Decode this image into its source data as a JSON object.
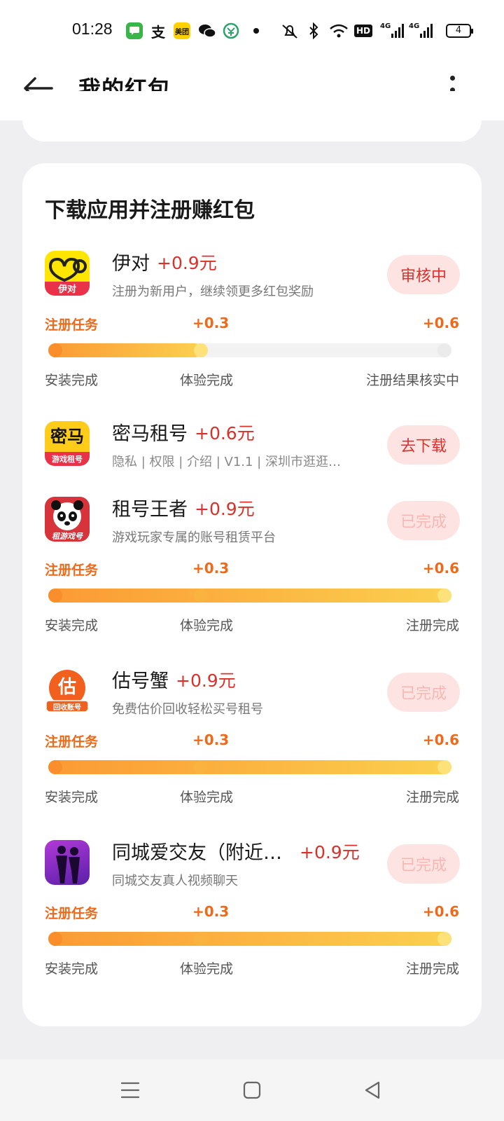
{
  "status_bar": {
    "time": "01:28",
    "battery": "4",
    "icons": [
      "messages-icon",
      "alipay-icon",
      "meituan-icon",
      "wechat-icon",
      "cmb-icon",
      "dot-icon",
      "mute-icon",
      "bluetooth-icon",
      "wifi-icon",
      "hd-icon",
      "signal-4g-icon",
      "signal-4g-icon"
    ],
    "meituan_label": "美团",
    "alipay_label": "支",
    "hd_label": "HD",
    "lte1": "4G",
    "lte2": "4G"
  },
  "header": {
    "title": "我的红包"
  },
  "section": {
    "title": "下载应用并注册赚红包"
  },
  "apps": [
    {
      "name": "伊对",
      "reward": "+0.9元",
      "desc": "注册为新用户，继续领更多红包奖励",
      "action": "审核中",
      "icon_text": "伊对",
      "has_task": true,
      "task_label": "注册任务",
      "reward_step2": "+0.3",
      "reward_step3": "+0.6",
      "steps": [
        "安装完成",
        "体验完成",
        "注册结果核实中"
      ],
      "progress": 0.38
    },
    {
      "name": "密马租号",
      "reward": "+0.6元",
      "desc": "隐私 | 权限 | 介绍 | V1.1 | 深圳市逛逛…",
      "action": "去下载",
      "icon_text": "密马",
      "icon_subtext": "游戏租号",
      "has_task": false
    },
    {
      "name": "租号王者",
      "reward": "+0.9元",
      "desc": "游戏玩家专属的账号租赁平台",
      "action": "已完成",
      "icon_text": "租游戏号",
      "has_task": true,
      "task_label": "注册任务",
      "reward_step2": "+0.3",
      "reward_step3": "+0.6",
      "steps": [
        "安装完成",
        "体验完成",
        "注册完成"
      ],
      "progress": 1.0
    },
    {
      "name": "估号蟹",
      "reward": "+0.9元",
      "desc": "免费估价回收轻松买号租号",
      "action": "已完成",
      "icon_text": "估",
      "icon_subtext": "回收账号",
      "has_task": true,
      "task_label": "注册任务",
      "reward_step2": "+0.3",
      "reward_step3": "+0.6",
      "steps": [
        "安装完成",
        "体验完成",
        "注册完成"
      ],
      "progress": 1.0
    },
    {
      "name": "同城爱交友（附近…",
      "reward": "+0.9元",
      "desc": "同城交友真人视频聊天",
      "action": "已完成",
      "has_task": true,
      "task_label": "注册任务",
      "reward_step2": "+0.3",
      "reward_step3": "+0.6",
      "steps": [
        "安装完成",
        "体验完成",
        "注册完成"
      ],
      "progress": 1.0
    }
  ],
  "nav": {
    "icons": [
      "menu-icon",
      "home-icon",
      "back-icon"
    ]
  },
  "colors": {
    "accent_red": "#d9322b",
    "task_orange": "#ee6a1a",
    "progress_start": "#fb9a33",
    "progress_end": "#fbd04f"
  }
}
